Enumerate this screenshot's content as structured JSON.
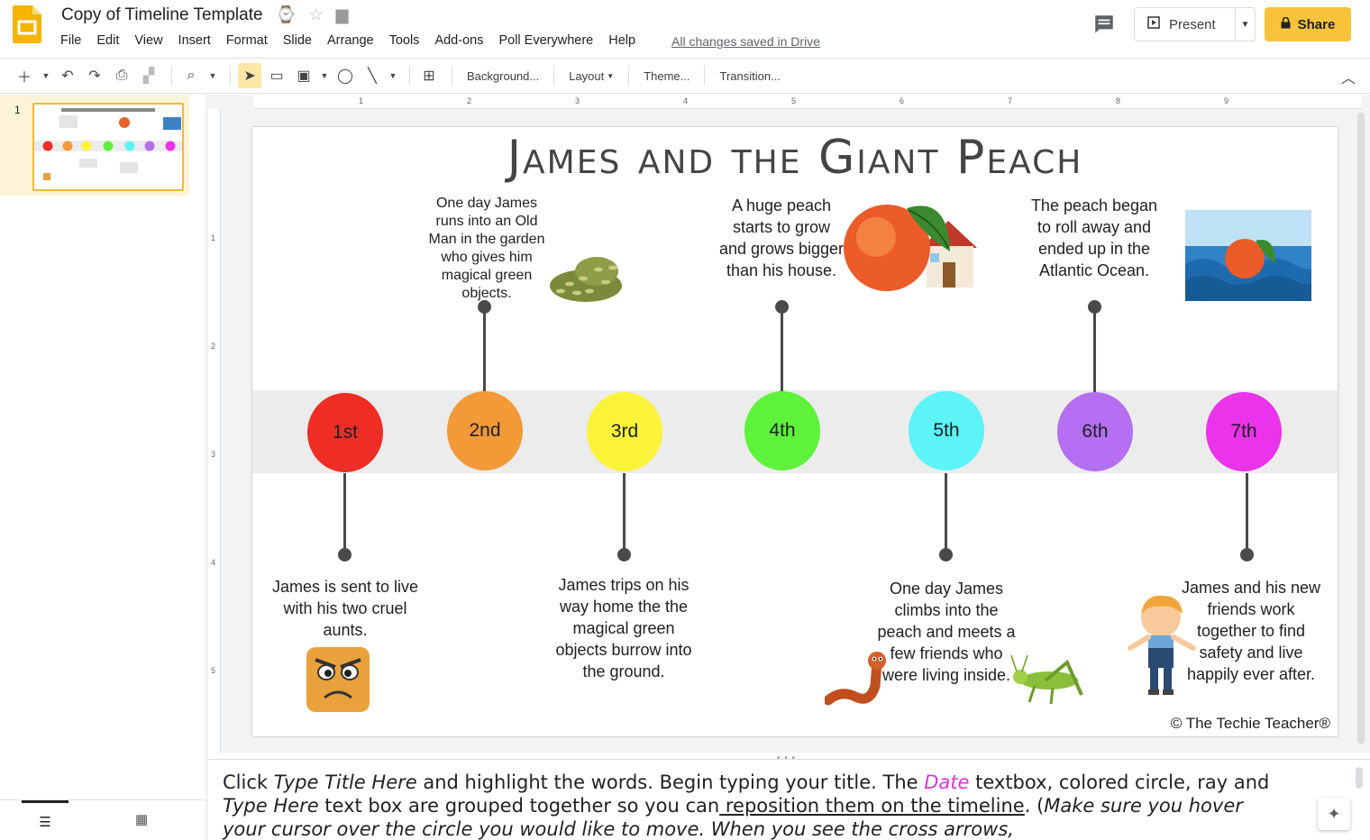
{
  "app": {
    "doc_title": "Copy of Timeline Template",
    "saved_status": "All changes saved in Drive",
    "present_label": "Present",
    "share_label": "Share"
  },
  "menu": [
    "File",
    "Edit",
    "View",
    "Insert",
    "Format",
    "Slide",
    "Arrange",
    "Tools",
    "Add-ons",
    "Poll Everywhere",
    "Help"
  ],
  "toolbar": {
    "background": "Background...",
    "layout": "Layout",
    "theme": "Theme...",
    "transition": "Transition..."
  },
  "filmstrip": {
    "slide_number": "1"
  },
  "ruler": {
    "top": [
      "1",
      "2",
      "3",
      "4",
      "5",
      "6",
      "7",
      "8",
      "9"
    ],
    "left": [
      "1",
      "2",
      "3",
      "4",
      "5"
    ]
  },
  "slide": {
    "title": "James and the Giant Peach",
    "copyright": "© The Techie Teacher®",
    "events": [
      {
        "label": "1st",
        "color": "#ee2e24",
        "text": "James is sent to live with his two cruel aunts."
      },
      {
        "label": "2nd",
        "color": "#f29a38",
        "text": "One day James runs into an Old Man in the garden who gives him magical green objects."
      },
      {
        "label": "3rd",
        "color": "#fbf33a",
        "text": "James trips on his way home the the magical green objects burrow into the ground."
      },
      {
        "label": "4th",
        "color": "#5ef23a",
        "text": "A huge peach starts to grow and grows bigger than his house."
      },
      {
        "label": "5th",
        "color": "#5cf4f7",
        "text": "One day James climbs into the peach and meets a few friends who were living inside."
      },
      {
        "label": "6th",
        "color": "#b46ff2",
        "text": "The peach began to roll away and ended up in the Atlantic Ocean."
      },
      {
        "label": "7th",
        "color": "#ea33ea",
        "text": "James and his new friends work together to find safety and live happily ever after."
      }
    ]
  },
  "notes": {
    "p1": "Click ",
    "p2": "Type Title Here",
    "p3": " and highlight the words. Begin typing your title. The ",
    "p4": "Date",
    "p5": " textbox, colored circle, ray and ",
    "p6": "Type Here",
    "p7": " text box are grouped together so you can",
    "p8": " reposition them on the timeline",
    "p9": ". (",
    "p10": "Make sure you hover your cursor over the circle you would like to move. When you see the cross arrows,"
  }
}
